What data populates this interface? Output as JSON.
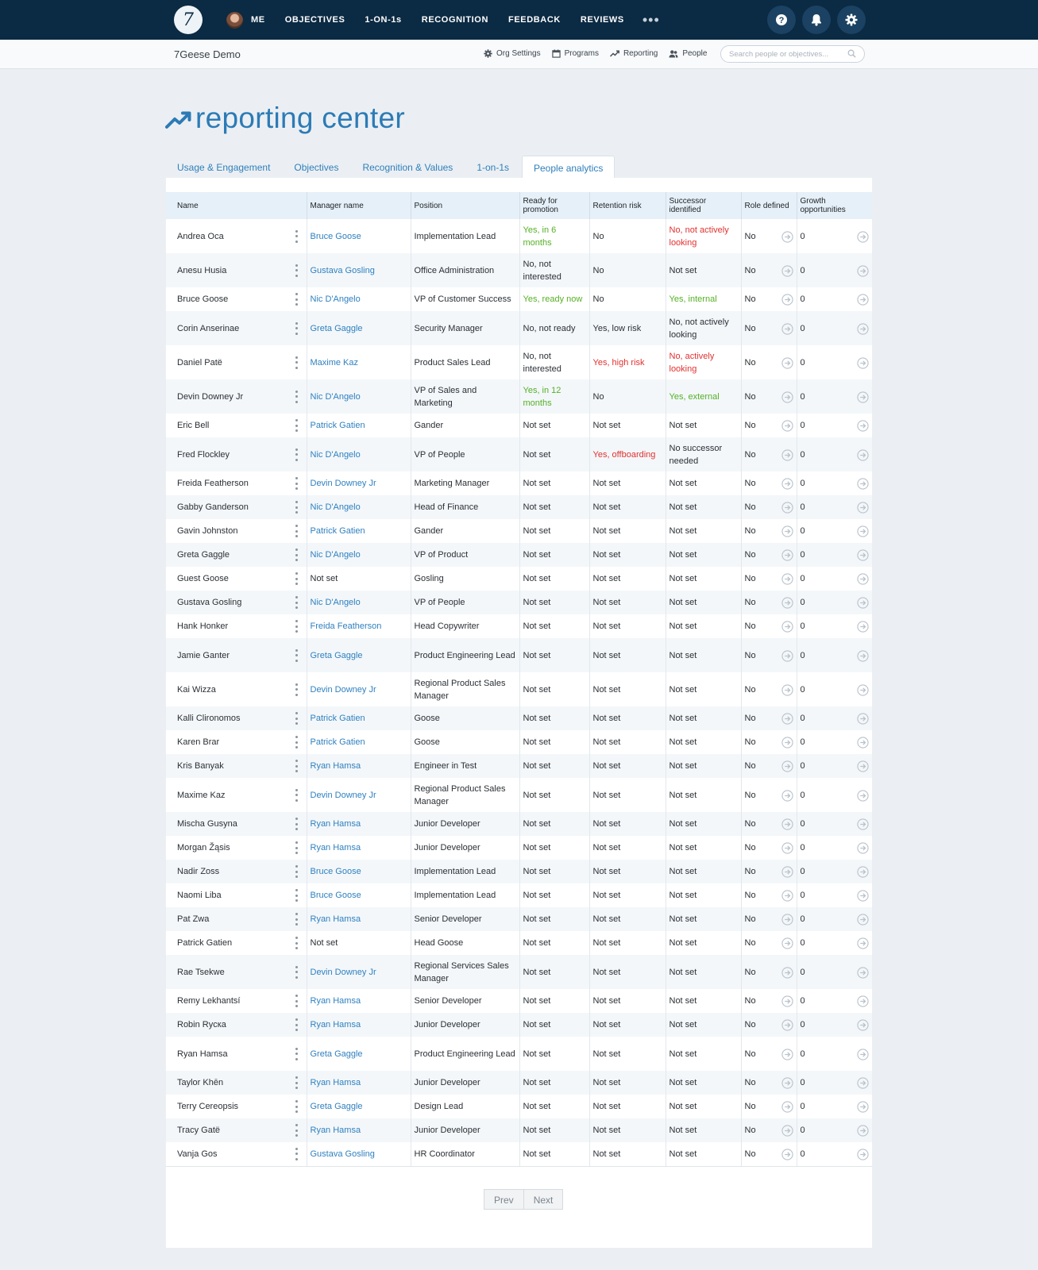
{
  "nav": {
    "logo_glyph": "7",
    "items": [
      "ME",
      "OBJECTIVES",
      "1-ON-1s",
      "RECOGNITION",
      "FEEDBACK",
      "REVIEWS"
    ],
    "more": "•••",
    "help_icon": "question-icon",
    "bell_icon": "bell-icon",
    "settings_icon": "gear-icon"
  },
  "subbar": {
    "org_name": "7Geese Demo",
    "links": [
      "Org Settings",
      "Programs",
      "Reporting",
      "People"
    ],
    "search_placeholder": "Search people or objectives..."
  },
  "page": {
    "title": "reporting center"
  },
  "tabs": [
    "Usage & Engagement",
    "Objectives",
    "Recognition & Values",
    "1-on-1s",
    "People analytics"
  ],
  "active_tab": "People analytics",
  "colors": {
    "nav_bg": "#0b2a43",
    "accent": "#2f80bf",
    "positive": "#55b025",
    "negative": "#e1312f"
  },
  "table": {
    "headers": [
      "Name",
      "Manager name",
      "Position",
      "Ready for promotion",
      "Retention risk",
      "Successor identified",
      "Role defined",
      "Growth opportunities"
    ],
    "rows": [
      {
        "name": "Andrea Oca",
        "manager": "Bruce Goose",
        "position": "Implementation Lead",
        "ready": "Yes, in 6 months",
        "ready_tone": "green",
        "risk": "No",
        "risk_tone": "",
        "succ": "No, not actively looking",
        "succ_tone": "red",
        "role": "No",
        "growth": "0"
      },
      {
        "name": "Anesu Husia",
        "manager": "Gustava Gosling",
        "position": "Office Administration",
        "ready": "No, not interested",
        "ready_tone": "",
        "risk": "No",
        "risk_tone": "",
        "succ": "Not set",
        "succ_tone": "",
        "role": "No",
        "growth": "0"
      },
      {
        "name": "Bruce Goose",
        "manager": "Nic D'Angelo",
        "position": "VP of Customer Success",
        "ready": "Yes, ready now",
        "ready_tone": "green",
        "risk": "No",
        "risk_tone": "",
        "succ": "Yes, internal",
        "succ_tone": "green",
        "role": "No",
        "growth": "0"
      },
      {
        "name": "Corin Anserinae",
        "manager": "Greta Gaggle",
        "position": "Security Manager",
        "ready": "No, not ready",
        "ready_tone": "",
        "risk": "Yes, low risk",
        "risk_tone": "",
        "succ": "No, not actively looking",
        "succ_tone": "",
        "role": "No",
        "growth": "0"
      },
      {
        "name": "Daniel Patë",
        "manager": "Maxime Kaz",
        "position": "Product Sales Lead",
        "ready": "No, not interested",
        "ready_tone": "",
        "risk": "Yes, high risk",
        "risk_tone": "red",
        "succ": "No, actively looking",
        "succ_tone": "red",
        "role": "No",
        "growth": "0"
      },
      {
        "name": "Devin Downey Jr",
        "manager": "Nic D'Angelo",
        "position": "VP of Sales and Marketing",
        "ready": "Yes, in 12 months",
        "ready_tone": "green",
        "risk": "No",
        "risk_tone": "",
        "succ": "Yes, external",
        "succ_tone": "green",
        "role": "No",
        "growth": "0"
      },
      {
        "name": "Eric Bell",
        "manager": "Patrick Gatien",
        "position": "Gander",
        "ready": "Not set",
        "ready_tone": "",
        "risk": "Not set",
        "risk_tone": "",
        "succ": "Not set",
        "succ_tone": "",
        "role": "No",
        "growth": "0"
      },
      {
        "name": "Fred Flockley",
        "manager": "Nic D'Angelo",
        "position": "VP of People",
        "ready": "Not set",
        "ready_tone": "",
        "risk": "Yes, offboarding",
        "risk_tone": "red",
        "succ": "No successor needed",
        "succ_tone": "",
        "role": "No",
        "growth": "0"
      },
      {
        "name": "Freida Featherson",
        "manager": "Devin Downey Jr",
        "position": "Marketing Manager",
        "ready": "Not set",
        "ready_tone": "",
        "risk": "Not set",
        "risk_tone": "",
        "succ": "Not set",
        "succ_tone": "",
        "role": "No",
        "growth": "0"
      },
      {
        "name": "Gabby Ganderson",
        "manager": "Nic D'Angelo",
        "position": "Head of Finance",
        "ready": "Not set",
        "ready_tone": "",
        "risk": "Not set",
        "risk_tone": "",
        "succ": "Not set",
        "succ_tone": "",
        "role": "No",
        "growth": "0"
      },
      {
        "name": "Gavin Johnston",
        "manager": "Patrick Gatien",
        "position": "Gander",
        "ready": "Not set",
        "ready_tone": "",
        "risk": "Not set",
        "risk_tone": "",
        "succ": "Not set",
        "succ_tone": "",
        "role": "No",
        "growth": "0"
      },
      {
        "name": "Greta Gaggle",
        "manager": "Nic D'Angelo",
        "position": "VP of Product",
        "ready": "Not set",
        "ready_tone": "",
        "risk": "Not set",
        "risk_tone": "",
        "succ": "Not set",
        "succ_tone": "",
        "role": "No",
        "growth": "0"
      },
      {
        "name": "Guest Goose",
        "manager": "Not set",
        "position": "Gosling",
        "ready": "Not set",
        "ready_tone": "",
        "risk": "Not set",
        "risk_tone": "",
        "succ": "Not set",
        "succ_tone": "",
        "role": "No",
        "growth": "0"
      },
      {
        "name": "Gustava Gosling",
        "manager": "Nic D'Angelo",
        "position": "VP of People",
        "ready": "Not set",
        "ready_tone": "",
        "risk": "Not set",
        "risk_tone": "",
        "succ": "Not set",
        "succ_tone": "",
        "role": "No",
        "growth": "0"
      },
      {
        "name": "Hank Honker",
        "manager": "Freida Featherson",
        "position": "Head Copywriter",
        "ready": "Not set",
        "ready_tone": "",
        "risk": "Not set",
        "risk_tone": "",
        "succ": "Not set",
        "succ_tone": "",
        "role": "No",
        "growth": "0"
      },
      {
        "name": "Jamie Ganter",
        "manager": "Greta Gaggle",
        "position": "Product Engineering Lead",
        "ready": "Not set",
        "ready_tone": "",
        "risk": "Not set",
        "risk_tone": "",
        "succ": "Not set",
        "succ_tone": "",
        "role": "No",
        "growth": "0"
      },
      {
        "name": "Kai Wizza",
        "manager": "Devin Downey Jr",
        "position": "Regional Product Sales Manager",
        "ready": "Not set",
        "ready_tone": "",
        "risk": "Not set",
        "risk_tone": "",
        "succ": "Not set",
        "succ_tone": "",
        "role": "No",
        "growth": "0"
      },
      {
        "name": "Kalli Clironomos",
        "manager": "Patrick Gatien",
        "position": "Goose",
        "ready": "Not set",
        "ready_tone": "",
        "risk": "Not set",
        "risk_tone": "",
        "succ": "Not set",
        "succ_tone": "",
        "role": "No",
        "growth": "0"
      },
      {
        "name": "Karen Brar",
        "manager": "Patrick Gatien",
        "position": "Goose",
        "ready": "Not set",
        "ready_tone": "",
        "risk": "Not set",
        "risk_tone": "",
        "succ": "Not set",
        "succ_tone": "",
        "role": "No",
        "growth": "0"
      },
      {
        "name": "Kris Banyak",
        "manager": "Ryan Hamsa",
        "position": "Engineer in Test",
        "ready": "Not set",
        "ready_tone": "",
        "risk": "Not set",
        "risk_tone": "",
        "succ": "Not set",
        "succ_tone": "",
        "role": "No",
        "growth": "0"
      },
      {
        "name": "Maxime Kaz",
        "manager": "Devin Downey Jr",
        "position": "Regional Product Sales Manager",
        "ready": "Not set",
        "ready_tone": "",
        "risk": "Not set",
        "risk_tone": "",
        "succ": "Not set",
        "succ_tone": "",
        "role": "No",
        "growth": "0"
      },
      {
        "name": "Mischa Gusyna",
        "manager": "Ryan Hamsa",
        "position": "Junior Developer",
        "ready": "Not set",
        "ready_tone": "",
        "risk": "Not set",
        "risk_tone": "",
        "succ": "Not set",
        "succ_tone": "",
        "role": "No",
        "growth": "0"
      },
      {
        "name": "Morgan Žąsis",
        "manager": "Ryan Hamsa",
        "position": "Junior Developer",
        "ready": "Not set",
        "ready_tone": "",
        "risk": "Not set",
        "risk_tone": "",
        "succ": "Not set",
        "succ_tone": "",
        "role": "No",
        "growth": "0"
      },
      {
        "name": "Nadir Zoss",
        "manager": "Bruce Goose",
        "position": "Implementation Lead",
        "ready": "Not set",
        "ready_tone": "",
        "risk": "Not set",
        "risk_tone": "",
        "succ": "Not set",
        "succ_tone": "",
        "role": "No",
        "growth": "0"
      },
      {
        "name": "Naomi Liba",
        "manager": "Bruce Goose",
        "position": "Implementation Lead",
        "ready": "Not set",
        "ready_tone": "",
        "risk": "Not set",
        "risk_tone": "",
        "succ": "Not set",
        "succ_tone": "",
        "role": "No",
        "growth": "0"
      },
      {
        "name": "Pat Zwa",
        "manager": "Ryan Hamsa",
        "position": "Senior Developer",
        "ready": "Not set",
        "ready_tone": "",
        "risk": "Not set",
        "risk_tone": "",
        "succ": "Not set",
        "succ_tone": "",
        "role": "No",
        "growth": "0"
      },
      {
        "name": "Patrick Gatien",
        "manager": "Not set",
        "position": "Head Goose",
        "ready": "Not set",
        "ready_tone": "",
        "risk": "Not set",
        "risk_tone": "",
        "succ": "Not set",
        "succ_tone": "",
        "role": "No",
        "growth": "0"
      },
      {
        "name": "Rae Tsekwe",
        "manager": "Devin Downey Jr",
        "position": "Regional Services Sales Manager",
        "ready": "Not set",
        "ready_tone": "",
        "risk": "Not set",
        "risk_tone": "",
        "succ": "Not set",
        "succ_tone": "",
        "role": "No",
        "growth": "0"
      },
      {
        "name": "Remy Lekhantsí",
        "manager": "Ryan Hamsa",
        "position": "Senior Developer",
        "ready": "Not set",
        "ready_tone": "",
        "risk": "Not set",
        "risk_tone": "",
        "succ": "Not set",
        "succ_tone": "",
        "role": "No",
        "growth": "0"
      },
      {
        "name": "Robin Rycка",
        "manager": "Ryan Hamsa",
        "position": "Junior Developer",
        "ready": "Not set",
        "ready_tone": "",
        "risk": "Not set",
        "risk_tone": "",
        "succ": "Not set",
        "succ_tone": "",
        "role": "No",
        "growth": "0"
      },
      {
        "name": "Ryan Hamsa",
        "manager": "Greta Gaggle",
        "position": "Product Engineering Lead",
        "ready": "Not set",
        "ready_tone": "",
        "risk": "Not set",
        "risk_tone": "",
        "succ": "Not set",
        "succ_tone": "",
        "role": "No",
        "growth": "0"
      },
      {
        "name": "Taylor Khēn",
        "manager": "Ryan Hamsa",
        "position": "Junior Developer",
        "ready": "Not set",
        "ready_tone": "",
        "risk": "Not set",
        "risk_tone": "",
        "succ": "Not set",
        "succ_tone": "",
        "role": "No",
        "growth": "0"
      },
      {
        "name": "Terry Cereopsis",
        "manager": "Greta Gaggle",
        "position": "Design Lead",
        "ready": "Not set",
        "ready_tone": "",
        "risk": "Not set",
        "risk_tone": "",
        "succ": "Not set",
        "succ_tone": "",
        "role": "No",
        "growth": "0"
      },
      {
        "name": "Tracy Gatë",
        "manager": "Ryan Hamsa",
        "position": "Junior Developer",
        "ready": "Not set",
        "ready_tone": "",
        "risk": "Not set",
        "risk_tone": "",
        "succ": "Not set",
        "succ_tone": "",
        "role": "No",
        "growth": "0"
      },
      {
        "name": "Vanja Gos",
        "manager": "Gustava Gosling",
        "position": "HR Coordinator",
        "ready": "Not set",
        "ready_tone": "",
        "risk": "Not set",
        "risk_tone": "",
        "succ": "Not set",
        "succ_tone": "",
        "role": "No",
        "growth": "0"
      }
    ]
  },
  "pager": {
    "prev": "Prev",
    "next": "Next"
  }
}
